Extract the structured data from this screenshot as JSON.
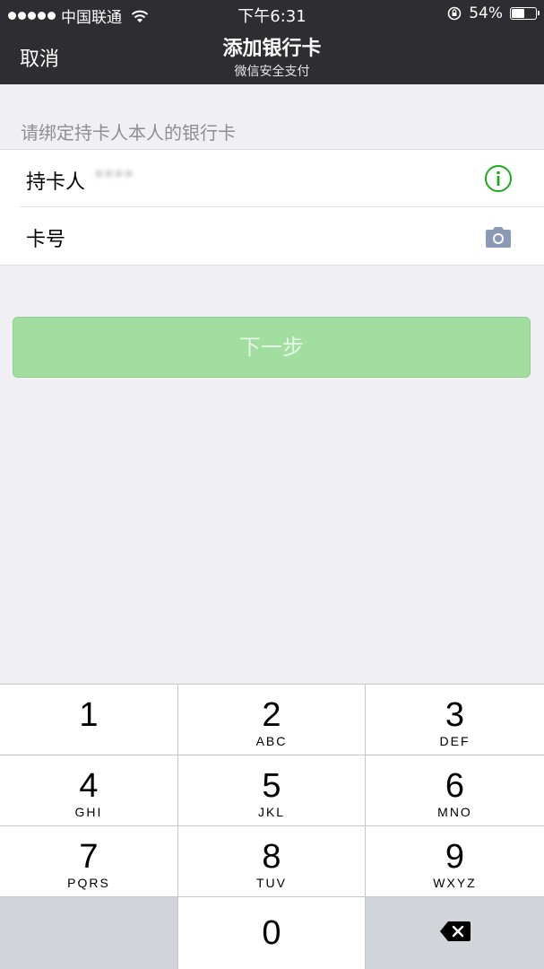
{
  "status_bar": {
    "carrier": "中国联通",
    "time": "下午6:31",
    "battery": "54%",
    "battery_level": 0.54
  },
  "nav": {
    "cancel_label": "取消",
    "title": "添加银行卡",
    "subtitle": "微信安全支付"
  },
  "form": {
    "hint": "请绑定持卡人本人的银行卡",
    "cardholder_label": "持卡人",
    "cardholder_value": "****",
    "card_number_label": "卡号",
    "card_number_value": ""
  },
  "next_button": {
    "label": "下一步"
  },
  "keyboard": {
    "keys": [
      {
        "digit": "1",
        "letters": ""
      },
      {
        "digit": "2",
        "letters": "ABC"
      },
      {
        "digit": "3",
        "letters": "DEF"
      },
      {
        "digit": "4",
        "letters": "GHI"
      },
      {
        "digit": "5",
        "letters": "JKL"
      },
      {
        "digit": "6",
        "letters": "MNO"
      },
      {
        "digit": "7",
        "letters": "PQRS"
      },
      {
        "digit": "8",
        "letters": "TUV"
      },
      {
        "digit": "9",
        "letters": "WXYZ"
      },
      {
        "digit": "0",
        "letters": ""
      }
    ]
  },
  "colors": {
    "nav_bg": "#2e2d32",
    "page_bg": "#efeff4",
    "next_button_bg": "#a1dea0",
    "info_icon": "#1aad19",
    "camera_icon": "#8a9ab6"
  }
}
